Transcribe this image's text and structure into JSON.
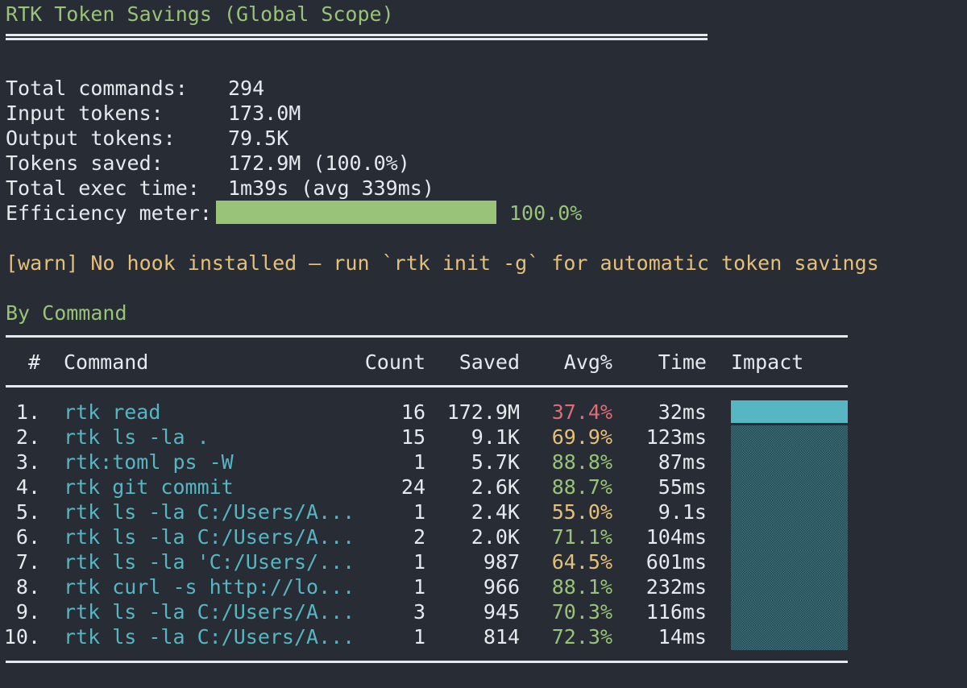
{
  "title": "RTK Token Savings (Global Scope)",
  "summary": [
    {
      "label": "Total commands:",
      "value": "294"
    },
    {
      "label": "Input tokens:",
      "value": "173.0M"
    },
    {
      "label": "Output tokens:",
      "value": "79.5K"
    },
    {
      "label": "Tokens saved:",
      "value": "172.9M (100.0%)"
    },
    {
      "label": "Total exec time:",
      "value": "1m39s (avg 339ms)"
    }
  ],
  "efficiency": {
    "label": "Efficiency meter:",
    "percent_text": "100.0%",
    "fraction": 1.0
  },
  "warning": "[warn] No hook installed — run `rtk init -g` for automatic token savings",
  "section_title": "By Command",
  "table": {
    "headers": {
      "num": "#",
      "command": "Command",
      "count": "Count",
      "saved": "Saved",
      "avg": "Avg%",
      "time": "Time",
      "impact": "Impact"
    },
    "rows": [
      {
        "num": "1.",
        "command": "rtk read",
        "count": "16",
        "saved": "172.9M",
        "avg": "37.4%",
        "avg_color": "#e06c75",
        "time": "32ms",
        "impact": 1.0,
        "impact_style": "solid"
      },
      {
        "num": "2.",
        "command": "rtk ls -la .",
        "count": "15",
        "saved": "9.1K",
        "avg": "69.9%",
        "avg_color": "#e5c07b",
        "time": "123ms",
        "impact": 1.0,
        "impact_style": "shade"
      },
      {
        "num": "3.",
        "command": "rtk:toml ps -W",
        "count": "1",
        "saved": "5.7K",
        "avg": "88.8%",
        "avg_color": "#98c379",
        "time": "87ms",
        "impact": 1.0,
        "impact_style": "shade"
      },
      {
        "num": "4.",
        "command": "rtk git commit",
        "count": "24",
        "saved": "2.6K",
        "avg": "88.7%",
        "avg_color": "#98c379",
        "time": "55ms",
        "impact": 1.0,
        "impact_style": "shade"
      },
      {
        "num": "5.",
        "command": "rtk ls -la C:/Users/A...",
        "count": "1",
        "saved": "2.4K",
        "avg": "55.0%",
        "avg_color": "#e5c07b",
        "time": "9.1s",
        "impact": 1.0,
        "impact_style": "shade"
      },
      {
        "num": "6.",
        "command": "rtk ls -la C:/Users/A...",
        "count": "2",
        "saved": "2.0K",
        "avg": "71.1%",
        "avg_color": "#98c379",
        "time": "104ms",
        "impact": 1.0,
        "impact_style": "shade"
      },
      {
        "num": "7.",
        "command": "rtk ls -la 'C:/Users/...",
        "count": "1",
        "saved": "987",
        "avg": "64.5%",
        "avg_color": "#e5c07b",
        "time": "601ms",
        "impact": 1.0,
        "impact_style": "shade"
      },
      {
        "num": "8.",
        "command": "rtk curl -s http://lo...",
        "count": "1",
        "saved": "966",
        "avg": "88.1%",
        "avg_color": "#98c379",
        "time": "232ms",
        "impact": 1.0,
        "impact_style": "shade"
      },
      {
        "num": "9.",
        "command": "rtk ls -la C:/Users/A...",
        "count": "3",
        "saved": "945",
        "avg": "70.3%",
        "avg_color": "#98c379",
        "time": "116ms",
        "impact": 1.0,
        "impact_style": "shade"
      },
      {
        "num": "10.",
        "command": "rtk ls -la C:/Users/A...",
        "count": "1",
        "saved": "814",
        "avg": "72.3%",
        "avg_color": "#98c379",
        "time": "14ms",
        "impact": 1.0,
        "impact_style": "shade"
      }
    ]
  },
  "colors": {
    "background": "#282c34",
    "text": "#e6e9ee",
    "green": "#98c379",
    "cyan": "#56b6c2",
    "yellow": "#e5c07b",
    "red": "#e06c75"
  }
}
